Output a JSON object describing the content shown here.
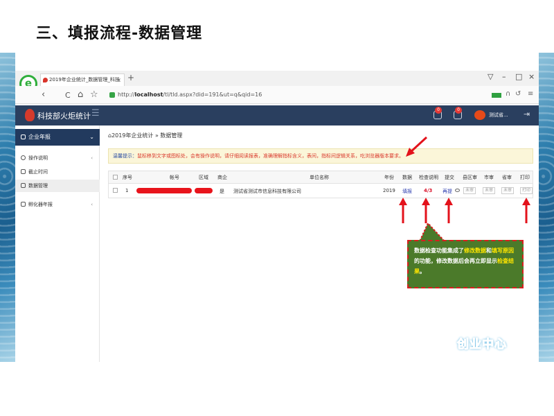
{
  "slide_title": "三、填报流程-数据管理",
  "browser": {
    "tab_title": "2019年企业统计_数据管理_科技",
    "tab_close": "×",
    "new_tab": "+",
    "url_scheme": "http://",
    "url_host": "localhost",
    "url_path": "/tl/tld.aspx?did=191&ut=q&qid=16",
    "back": "‹",
    "refresh": "C",
    "home": "⌂",
    "star": "☆",
    "win_min": "–",
    "win_max": "□",
    "win_close": "×",
    "win_pin": "▽"
  },
  "app": {
    "title": "科技部火炬统计",
    "menu_icon": "☰",
    "badge1": "0",
    "badge2": "0",
    "user": "测试省...",
    "logout": "⇥"
  },
  "sidebar": {
    "group": "企业年报",
    "group_chev": "⌄",
    "items": [
      {
        "label": "操作说明",
        "chev": "‹"
      },
      {
        "label": "截止时间",
        "chev": ""
      },
      {
        "label": "数据管理",
        "chev": ""
      }
    ],
    "group2": "孵化器年报",
    "group2_chev": "‹"
  },
  "breadcrumb": "2019年企业统计 » 数据管理",
  "notice": {
    "label": "温馨提示：",
    "text": "鼠标移到文字或图标处，会有操作说明，请仔细阅读报表，准确理解指标含义，表间，指标间逻辑关系，吃浏览器版本要求。"
  },
  "table": {
    "headers": {
      "seq": "序号",
      "account": "帐号",
      "region": "区域",
      "listed": "商企",
      "unit": "单位名称",
      "year": "年份",
      "data": "数据",
      "check": "检查说明",
      "submit": "提交",
      "county": "县区审",
      "city": "市审",
      "province": "省审",
      "print": "打印"
    },
    "rows": [
      {
        "seq": "1",
        "listed": "是",
        "unit": "测试省测试市信息科技有限公司",
        "year": "2019",
        "data": "填报",
        "check": "4/3",
        "submit": "再提",
        "county": "未审",
        "city": "未审",
        "province": "未审",
        "print": "打印"
      }
    ]
  },
  "callout": {
    "part1": "数据检查功能集成了",
    "hl1": "修改数据",
    "part2": "和",
    "hl2": "填写原因",
    "part3": "的功能，修改数据后会再立即显示",
    "hl3": "检查结果",
    "part4": "。"
  },
  "watermark": "创业中心",
  "colors": {
    "header": "#2a3f5f",
    "sidebar_active": "#223a5e",
    "accent_red": "#d9142c",
    "callout_bg": "#4b7a2a",
    "highlight": "#ffe600"
  }
}
